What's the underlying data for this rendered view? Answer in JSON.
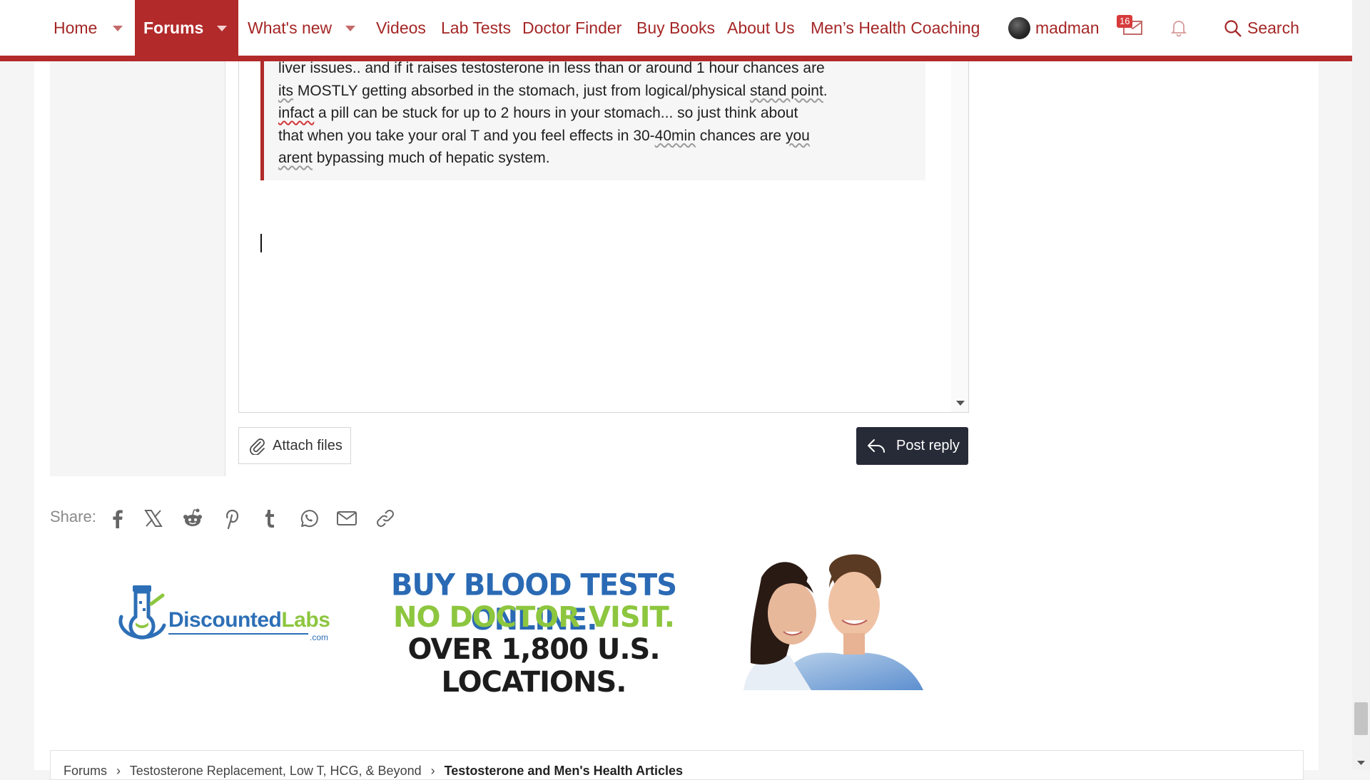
{
  "nav": {
    "home": "Home",
    "forums": "Forums",
    "whats_new": "What's new",
    "videos": "Videos",
    "lab_tests": "Lab Tests",
    "doctor_finder": "Doctor Finder",
    "buy_books": "Buy Books",
    "about_us": "About Us",
    "coaching": "Men’s Health Coaching",
    "username": "madman",
    "inbox_count": "16",
    "search": "Search"
  },
  "quote": {
    "line1": "liver issues.. and if it raises testosterone in less than or around 1 hour chances are",
    "line2_a": "its",
    "line2_b": " MOSTLY getting absorbed in the stomach, just from logical/physical ",
    "line2_c": "stand point",
    "line2_d": ".",
    "line3_a": "infact",
    "line3_b": " a pill can be stuck for up to 2 hours in your stomach... so just think about",
    "line4_a": "that when you take your oral T and you feel effects in 30-",
    "line4_b": "40min",
    "line4_c": " chances are ",
    "line4_d": "you",
    "line5_a": "arent",
    "line5_b": " bypassing much of hepatic system."
  },
  "buttons": {
    "attach_files": "Attach files",
    "post_reply": "Post reply"
  },
  "share": {
    "label": "Share:"
  },
  "ad": {
    "logo_name_1": "Discounted",
    "logo_name_2": "Labs",
    "logo_suffix": ".com",
    "headline_1": "BUY BLOOD TESTS ONLINE.",
    "headline_2": "NO DOCTOR VISIT.",
    "headline_3": "OVER 1,800 U.S. LOCATIONS."
  },
  "footer": {
    "crumb_1": "Forums",
    "crumb_2": "Testosterone Replacement, Low T, HCG, & Beyond",
    "crumb_3": "Testosterone and Men's Health Articles"
  },
  "colors": {
    "brand_red": "#b22a2a",
    "dark_button": "#272b38",
    "ad_blue": "#2a6ab4",
    "ad_green": "#8dc63f"
  }
}
